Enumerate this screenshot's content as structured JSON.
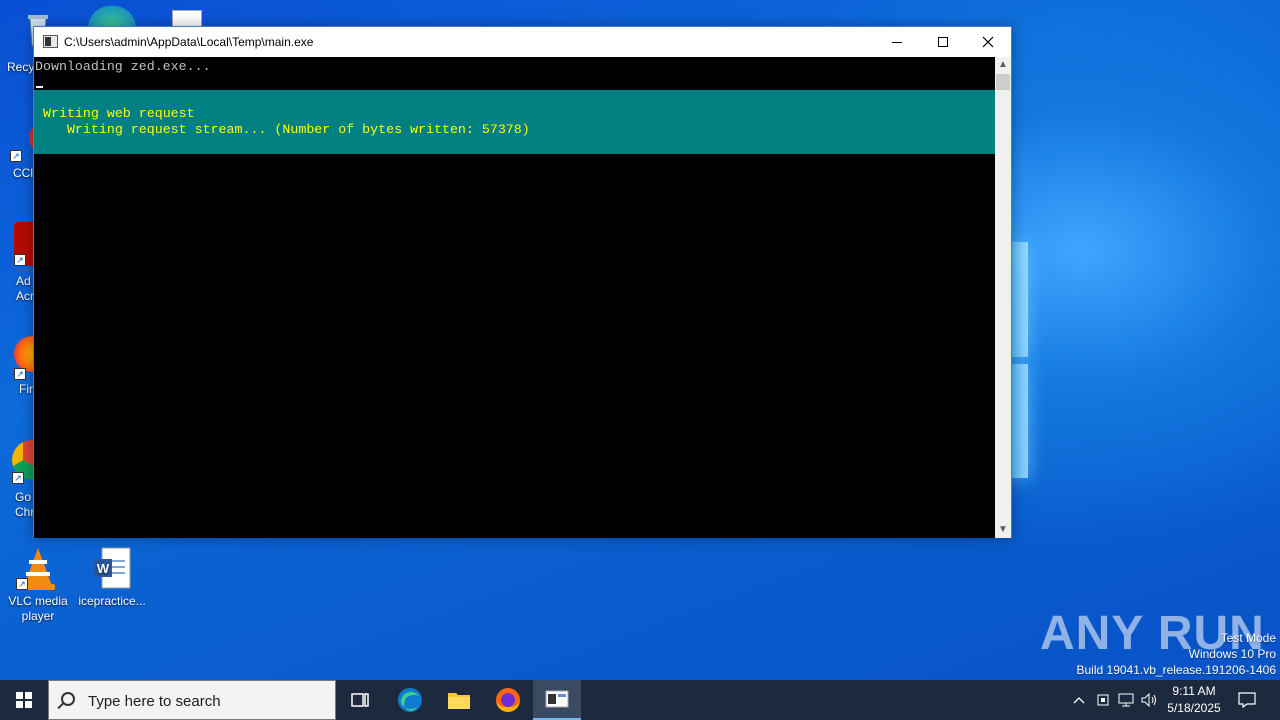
{
  "desktop": {
    "icons": [
      {
        "id": "recycle",
        "label": "Recy"
      },
      {
        "id": "ccleaner",
        "label": "CCl"
      },
      {
        "id": "acrobat",
        "label": "Ad\nAcr"
      },
      {
        "id": "firefox",
        "label": "Fir"
      },
      {
        "id": "chrome",
        "label": "Go\nChr"
      },
      {
        "id": "vlc",
        "label": "VLC media player"
      },
      {
        "id": "word",
        "label": "icepractice..."
      }
    ]
  },
  "console_window": {
    "title": "C:\\Users\\admin\\AppData\\Local\\Temp\\main.exe",
    "output_line": "Downloading zed.exe...",
    "progress_activity": "Writing web request",
    "progress_status": "   Writing request stream... (Number of bytes written: 57378)"
  },
  "watermark": {
    "brand": "ANY RUN",
    "test_mode": "Test Mode",
    "os": "Windows 10 Pro",
    "build": "Build 19041.vb_release.191206-1406"
  },
  "taskbar": {
    "search_placeholder": "Type here to search",
    "time": "9:11 AM",
    "date": "5/18/2025"
  },
  "colors": {
    "progress_bg": "#008080",
    "progress_text": "#ffff00",
    "console_text": "#c0c0c0",
    "taskbar_bg": "#1d2a3d"
  }
}
